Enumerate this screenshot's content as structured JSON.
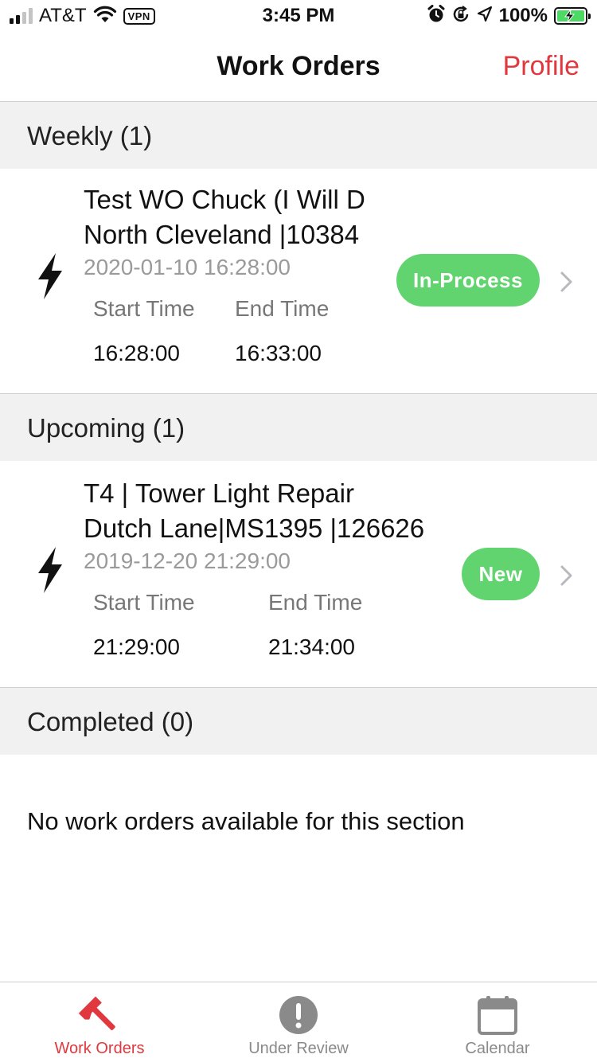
{
  "status_bar": {
    "carrier": "AT&T",
    "vpn": "VPN",
    "time": "3:45 PM",
    "battery": "100%",
    "icons": [
      "signal-icon",
      "wifi-icon",
      "alarm-icon",
      "orientation-lock-icon",
      "location-icon",
      "battery-charging-icon"
    ]
  },
  "nav": {
    "title": "Work Orders",
    "profile_label": "Profile"
  },
  "sections": {
    "weekly": {
      "header": "Weekly (1)",
      "items": [
        {
          "title_line1": "Test WO Chuck (I Will D",
          "title_line2": "North Cleveland |10384",
          "datetime": "2020-01-10 16:28:00",
          "start_label": "Start Time",
          "end_label": "End Time",
          "start_time": "16:28:00",
          "end_time": "16:33:00",
          "status": "In-Process",
          "icon": "lightning-bolt-icon"
        }
      ]
    },
    "upcoming": {
      "header": "Upcoming (1)",
      "items": [
        {
          "title_line1": "T4 | Tower Light Repair",
          "title_line2": "Dutch Lane|MS1395 |126626",
          "datetime": "2019-12-20 21:29:00",
          "start_label": "Start Time",
          "end_label": "End Time",
          "start_time": "21:29:00",
          "end_time": "21:34:00",
          "status": "New",
          "icon": "lightning-bolt-icon"
        }
      ]
    },
    "completed": {
      "header": "Completed (0)",
      "empty_message": "No work orders available for this section"
    }
  },
  "tabs": [
    {
      "label": "Work Orders",
      "icon": "hammer-icon",
      "active": true
    },
    {
      "label": "Under Review",
      "icon": "exclamation-icon",
      "active": false
    },
    {
      "label": "Calendar",
      "icon": "calendar-icon",
      "active": false
    }
  ],
  "colors": {
    "accent": "#e0383e",
    "badge_green": "#62d46f",
    "section_bg": "#f1f1f1",
    "battery_green": "#4cd964"
  }
}
